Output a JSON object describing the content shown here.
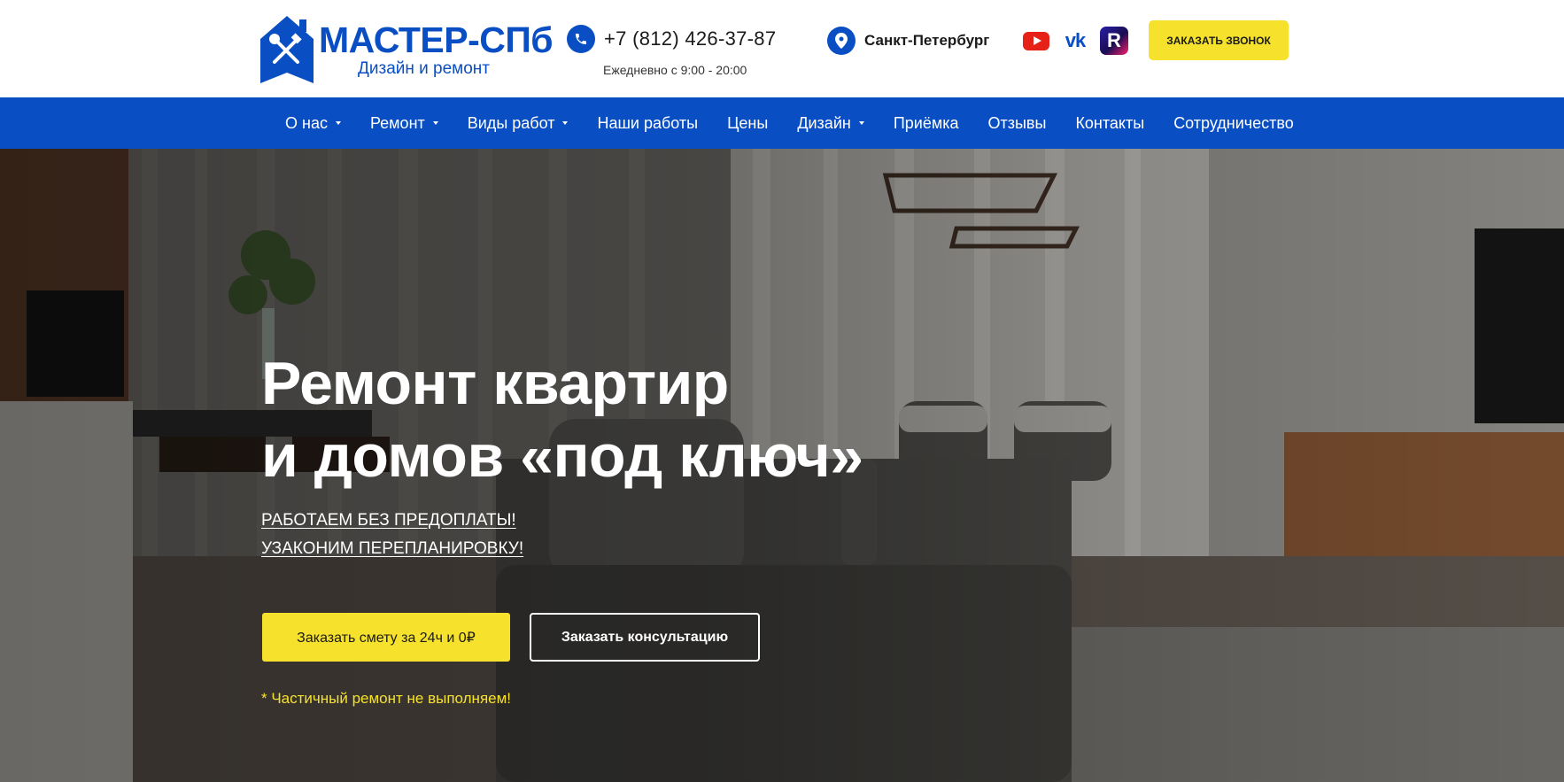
{
  "header": {
    "logo_title": "МАСТЕР-СПб",
    "logo_subtitle": "Дизайн и ремонт",
    "phone": "+7 (812) 426-37-87",
    "hours": "Ежедневно с 9:00 - 20:00",
    "city": "Санкт-Петербург",
    "socials": [
      {
        "icon": "youtube-icon"
      },
      {
        "icon": "vk-icon",
        "label": "vk"
      },
      {
        "icon": "rutube-icon",
        "label": "R"
      }
    ],
    "call_button": "ЗАКАЗАТЬ ЗВОНОК"
  },
  "nav": {
    "items": [
      {
        "label": "О нас",
        "dropdown": true
      },
      {
        "label": "Ремонт",
        "dropdown": true
      },
      {
        "label": "Виды работ",
        "dropdown": true
      },
      {
        "label": "Наши работы",
        "dropdown": false
      },
      {
        "label": "Цены",
        "dropdown": false
      },
      {
        "label": "Дизайн",
        "dropdown": true
      },
      {
        "label": "Приёмка",
        "dropdown": false
      },
      {
        "label": "Отзывы",
        "dropdown": false
      },
      {
        "label": "Контакты",
        "dropdown": false
      },
      {
        "label": "Сотрудничество",
        "dropdown": false
      }
    ]
  },
  "hero": {
    "title_line1": "Ремонт квартир",
    "title_line2": "и домов «под ключ»",
    "link1": "РАБОТАЕМ БЕЗ ПРЕДОПЛАТЫ!",
    "link2": "УЗАКОНИМ ПЕРЕПЛАНИРОВКУ!",
    "button_estimate": "Заказать смету за 24ч и 0₽",
    "button_consult": "Заказать консультацию",
    "note": "* Частичный ремонт не выполняем!"
  },
  "colors": {
    "brand_blue": "#0a4ec4",
    "accent_yellow": "#f6e22d",
    "youtube_red": "#e62117"
  }
}
